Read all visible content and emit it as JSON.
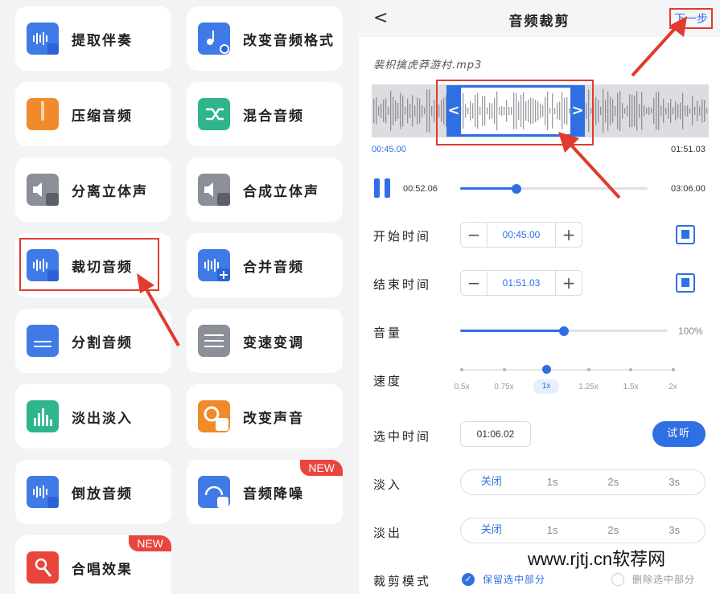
{
  "tools": [
    {
      "label": "提取伴奏",
      "color": "#3f7ae6"
    },
    {
      "label": "改变音频格式",
      "color": "#3f7ae6"
    },
    {
      "label": "压缩音频",
      "color": "#f08a2a"
    },
    {
      "label": "混合音频",
      "color": "#2fb58c"
    },
    {
      "label": "分离立体声",
      "color": "#8b8f97"
    },
    {
      "label": "合成立体声",
      "color": "#8b8f97"
    },
    {
      "label": "裁切音频",
      "color": "#3f7ae6"
    },
    {
      "label": "合并音频",
      "color": "#3f7ae6"
    },
    {
      "label": "分割音频",
      "color": "#3f7ae6"
    },
    {
      "label": "变速变调",
      "color": "#8b8f97"
    },
    {
      "label": "淡出淡入",
      "color": "#2fb58c"
    },
    {
      "label": "改变声音",
      "color": "#f08a2a"
    },
    {
      "label": "倒放音频",
      "color": "#3f7ae6"
    },
    {
      "label": "音频降噪",
      "color": "#3f7ae6",
      "badge": "NEW"
    },
    {
      "label": "合唱效果",
      "color": "#e8453c",
      "badge": "NEW"
    }
  ],
  "editor": {
    "back": "<",
    "title": "音频裁剪",
    "next": "下一步",
    "filename": "裴枳擒虎莽游村.mp3",
    "sel_start": "00:45.00",
    "sel_end": "01:51.03",
    "play_time": "00:52.06",
    "duration": "03:06.00",
    "playback_progress": 0.3,
    "start_label": "开始时间",
    "start_value": "00:45.00",
    "end_label": "结束时间",
    "end_value": "01:51.03",
    "volume_label": "音量",
    "volume_value": "100%",
    "volume_level": 0.5,
    "speed_label": "速度",
    "speeds": [
      "0.5x",
      "0.75x",
      "1x",
      "1.25x",
      "1.5x",
      "2x"
    ],
    "speed_selected": "1x",
    "selected_time_label": "选中时间",
    "selected_time": "01:06.02",
    "preview_button": "试听",
    "fade_in_label": "淡入",
    "fade_out_label": "淡出",
    "fade_options": [
      "关闭",
      "1s",
      "2s",
      "3s"
    ],
    "fade_selected": "关闭",
    "mode_label": "裁剪模式",
    "mode_keep": "保留选中部分",
    "mode_delete": "删除选中部分"
  },
  "watermark": "www.rjtj.cn软荐网",
  "colors": {
    "accent": "#2f6fe4",
    "highlight": "#e23a2e",
    "badge": "#e8453c"
  }
}
